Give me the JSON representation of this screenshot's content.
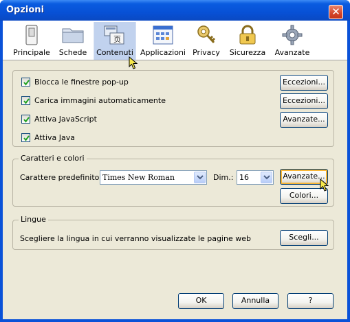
{
  "window": {
    "title": "Opzioni",
    "close_symbol": "✕"
  },
  "toolbar": {
    "panes": [
      {
        "label": "Principale",
        "icon": "switch-icon"
      },
      {
        "label": "Schede",
        "icon": "tabs-folder-icon"
      },
      {
        "label": "Contenuti",
        "icon": "content-icon",
        "selected": true
      },
      {
        "label": "Applicazioni",
        "icon": "applications-icon"
      },
      {
        "label": "Privacy",
        "icon": "key-icon"
      },
      {
        "label": "Sicurezza",
        "icon": "padlock-icon"
      },
      {
        "label": "Avanzate",
        "icon": "gear-icon"
      }
    ]
  },
  "content_options": {
    "items": [
      {
        "label": "Blocca le finestre pop-up",
        "checked": true,
        "button": "Eccezioni..."
      },
      {
        "label": "Carica immagini automaticamente",
        "checked": true,
        "button": "Eccezioni..."
      },
      {
        "label": "Attiva JavaScript",
        "checked": true,
        "button": "Avanzate..."
      },
      {
        "label": "Attiva Java",
        "checked": true
      }
    ]
  },
  "fonts": {
    "group_title": "Caratteri e colori",
    "default_font_label": "Carattere predefinito:",
    "default_font_value": "Times New Roman",
    "size_label": "Dim.:",
    "size_value": "16",
    "advanced_button": "Avanzate...",
    "colors_button": "Colori..."
  },
  "languages": {
    "group_title": "Lingue",
    "description": "Scegliere la lingua in cui verranno visualizzate le pagine web",
    "choose_button": "Scegli..."
  },
  "footer": {
    "ok": "OK",
    "cancel": "Annulla",
    "help": "?"
  },
  "colors": {
    "title_bar": "#0751d6",
    "dialog_bg": "#ece9d8",
    "selected_pane": "#c1d2ee",
    "button_hover": "#f8b636"
  }
}
